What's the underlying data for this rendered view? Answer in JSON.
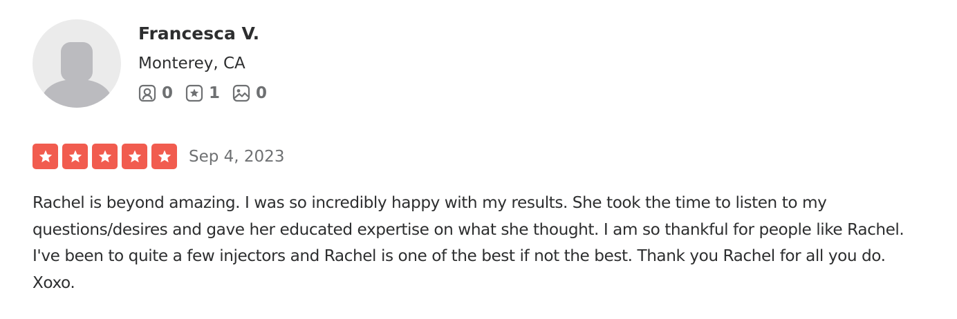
{
  "user": {
    "name": "Francesca V.",
    "location": "Monterey, CA",
    "stats": {
      "friends": "0",
      "reviews": "1",
      "photos": "0"
    }
  },
  "review": {
    "rating": 5,
    "rating_max": 5,
    "date": "Sep 4, 2023",
    "text": "Rachel is beyond amazing. I was so incredibly happy with my results. She took the time to listen to my questions/desires and gave her educated expertise on what she thought. I am so thankful for people like Rachel. I've been to quite a few injectors and Rachel is one of the best if not the best. Thank you Rachel for all you do. Xoxo."
  },
  "colors": {
    "star_fill": "#f15c4f",
    "text_primary": "#2d2e2f",
    "text_secondary": "#6e7072",
    "avatar_bg": "#ebebeb",
    "avatar_figure": "#bbbbbf"
  },
  "icons": {
    "avatar": "user-silhouette-icon",
    "friends": "friends-icon",
    "reviews": "review-star-icon",
    "photos": "photo-icon",
    "star": "star-icon"
  }
}
